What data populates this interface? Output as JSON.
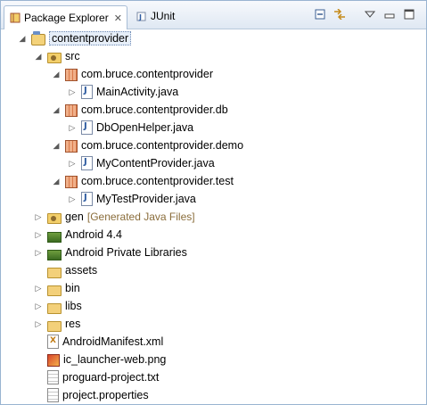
{
  "tabs": [
    {
      "label": "Package Explorer",
      "close": "☒",
      "icon": "package-explorer-icon"
    },
    {
      "label": "JUnit",
      "icon": "junit-icon"
    }
  ],
  "toolbar": [
    {
      "name": "collapse-all-icon"
    },
    {
      "name": "link-with-editor-icon"
    },
    {
      "name": "view-menu-icon"
    },
    {
      "name": "minimize-icon"
    },
    {
      "name": "maximize-icon"
    }
  ],
  "tree": [
    {
      "label": "contentprovider",
      "icon": "project-icon",
      "state": "expanded",
      "selected": true
    },
    {
      "label": "src",
      "icon": "source-folder-icon",
      "state": "expanded"
    },
    {
      "label": "com.bruce.contentprovider",
      "icon": "package-icon",
      "state": "expanded"
    },
    {
      "label": "MainActivity.java",
      "icon": "java-file-icon",
      "state": "collapsed"
    },
    {
      "label": "com.bruce.contentprovider.db",
      "icon": "package-icon",
      "state": "expanded"
    },
    {
      "label": "DbOpenHelper.java",
      "icon": "java-file-icon",
      "state": "collapsed"
    },
    {
      "label": "com.bruce.contentprovider.demo",
      "icon": "package-icon",
      "state": "expanded"
    },
    {
      "label": "MyContentProvider.java",
      "icon": "java-file-icon",
      "state": "collapsed"
    },
    {
      "label": "com.bruce.contentprovider.test",
      "icon": "package-icon",
      "state": "expanded"
    },
    {
      "label": "MyTestProvider.java",
      "icon": "java-file-icon",
      "state": "collapsed"
    },
    {
      "label": "gen",
      "decoration": "[Generated Java Files]",
      "icon": "source-folder-icon",
      "state": "collapsed"
    },
    {
      "label": "Android 4.4",
      "icon": "library-icon",
      "state": "collapsed"
    },
    {
      "label": "Android Private Libraries",
      "icon": "library-icon",
      "state": "collapsed"
    },
    {
      "label": "assets",
      "icon": "folder-icon",
      "state": "none"
    },
    {
      "label": "bin",
      "icon": "folder-icon",
      "state": "collapsed"
    },
    {
      "label": "libs",
      "icon": "folder-icon",
      "state": "collapsed"
    },
    {
      "label": "res",
      "icon": "folder-icon",
      "state": "collapsed"
    },
    {
      "label": "AndroidManifest.xml",
      "icon": "xml-file-icon",
      "state": "none"
    },
    {
      "label": "ic_launcher-web.png",
      "icon": "image-file-icon",
      "state": "none"
    },
    {
      "label": "proguard-project.txt",
      "icon": "text-file-icon",
      "state": "none"
    },
    {
      "label": "project.properties",
      "icon": "text-file-icon",
      "state": "none"
    }
  ],
  "colors": {
    "decoration": "#8a6d3b",
    "selection": "#e6eef8",
    "accent": "#99b4d1"
  }
}
